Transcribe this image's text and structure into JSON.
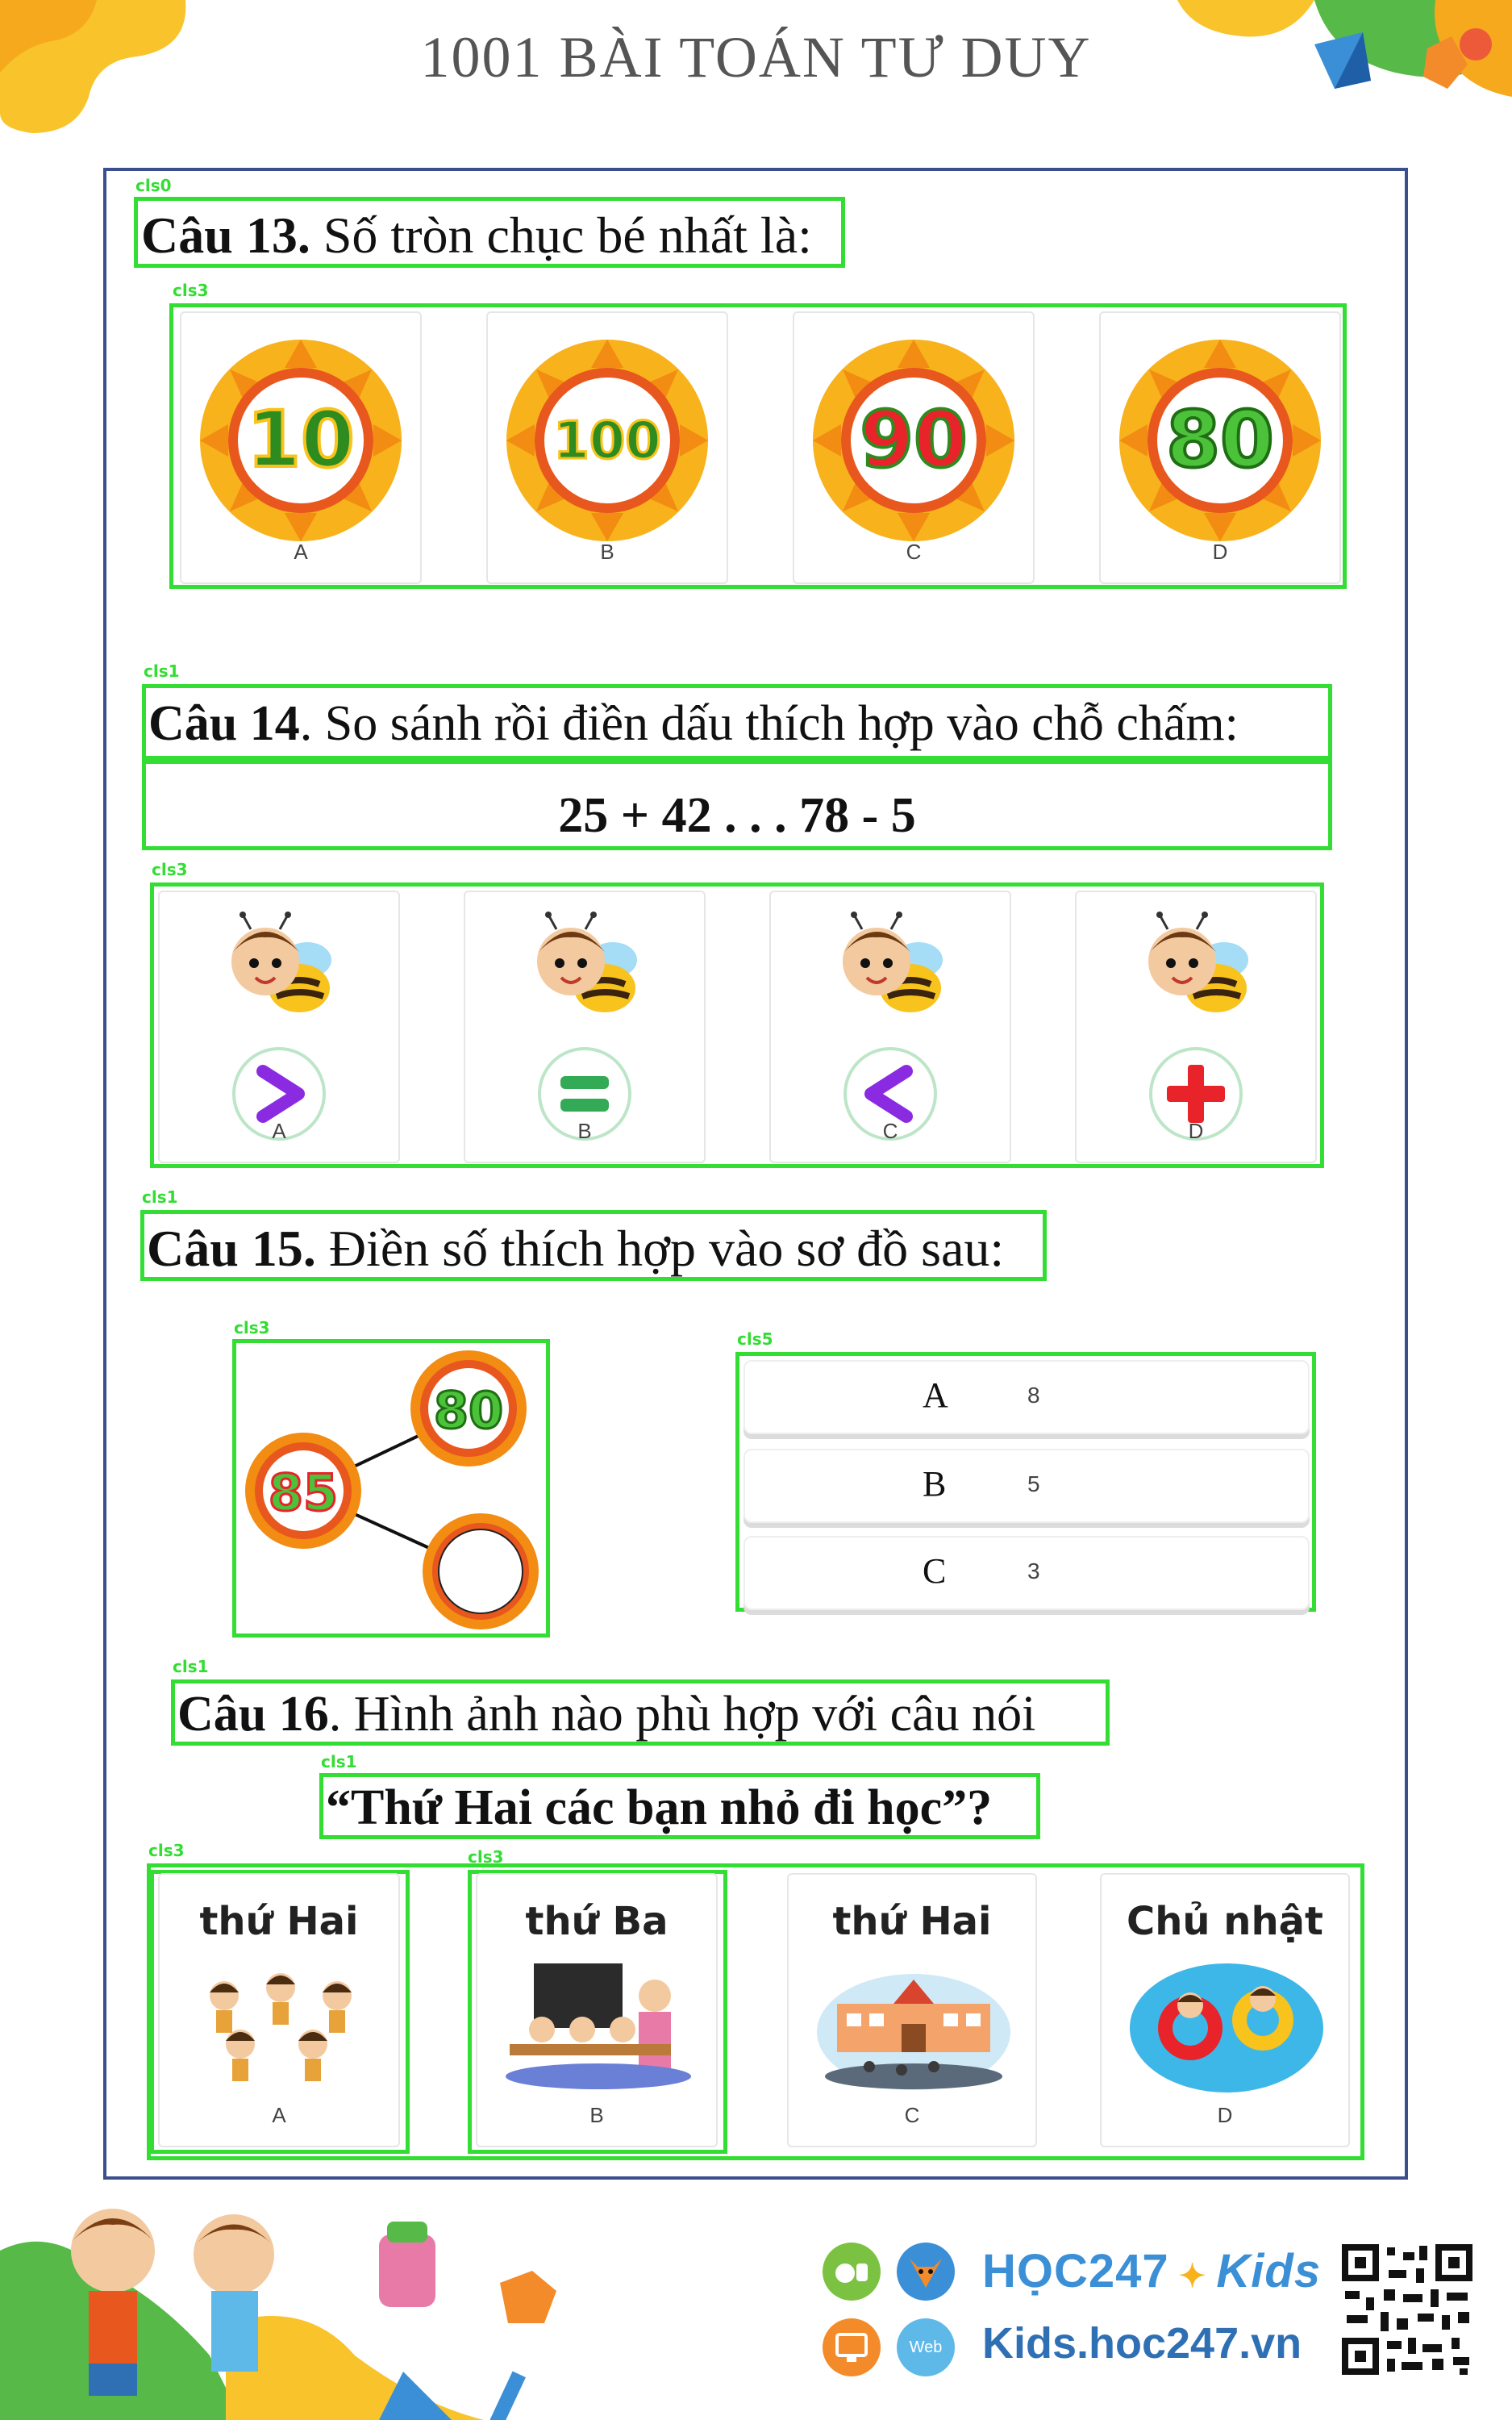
{
  "header": {
    "title": "1001 BÀI TOÁN TƯ DUY"
  },
  "labels": {
    "cls0": "cls0",
    "cls1": "cls1",
    "cls3": "cls3",
    "cls5": "cls5"
  },
  "q13": {
    "prefix": "Câu 13.",
    "text": " Số tròn chục bé nhất là:",
    "options": [
      {
        "letter": "A",
        "value": "10"
      },
      {
        "letter": "B",
        "value": "100"
      },
      {
        "letter": "C",
        "value": "90"
      },
      {
        "letter": "D",
        "value": "80"
      }
    ]
  },
  "q14": {
    "prefix": "Câu 14",
    "text": ". So sánh rồi điền dấu thích hợp vào chỗ chấm:",
    "expression": "25 + 42 . . . 78 - 5",
    "options": [
      {
        "letter": "A",
        "symbol": "greater-than"
      },
      {
        "letter": "B",
        "symbol": "equals"
      },
      {
        "letter": "C",
        "symbol": "less-than"
      },
      {
        "letter": "D",
        "symbol": "plus"
      }
    ]
  },
  "q15": {
    "prefix": "Câu 15.",
    "text": " Điền số thích hợp vào sơ đồ sau:",
    "diagram": {
      "left": "85",
      "top": "80",
      "bottom": ""
    },
    "options": [
      {
        "key": "A",
        "value": "8"
      },
      {
        "key": "B",
        "value": "5"
      },
      {
        "key": "C",
        "value": "3"
      }
    ]
  },
  "q16": {
    "prefix": "Câu 16",
    "text": ". Hình ảnh nào phù hợp với câu nói",
    "quote": "“Thứ Hai các bạn nhỏ đi học”?",
    "options": [
      {
        "letter": "A",
        "caption": "thứ Hai"
      },
      {
        "letter": "B",
        "caption": "thứ Ba"
      },
      {
        "letter": "C",
        "caption": "thứ Hai"
      },
      {
        "letter": "D",
        "caption": "Chủ nhật"
      }
    ]
  },
  "footer": {
    "brand": "HỌC247",
    "brand_suffix": "Kids",
    "website": "Kids.hoc247.vn",
    "web_badge": "Web"
  },
  "colors": {
    "green_box": "#33dd33",
    "frame": "#3b4f8c",
    "accent_purple": "#8a2be2",
    "accent_red": "#e8232a",
    "accent_green": "#33aa55"
  }
}
